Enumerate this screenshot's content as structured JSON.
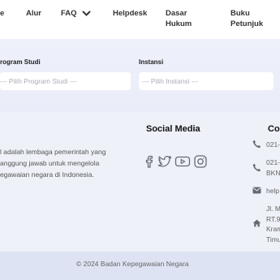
{
  "nav": {
    "items": [
      {
        "label": "e"
      },
      {
        "label": "Alur"
      },
      {
        "label": "FAQ"
      },
      {
        "label": "Helpdesk"
      },
      {
        "label_line1": "Dasar",
        "label_line2": "Hukum"
      },
      {
        "label_line1": "Buku",
        "label_line2": "Petunjuk"
      }
    ]
  },
  "filters": {
    "program_label": "rogram Studi",
    "program_placeholder": "--- Pilih Program Studi ---",
    "instansi_label": "Instansi",
    "instansi_placeholder": "--- Pilih Instansi ---"
  },
  "footer": {
    "about_lines": [
      "l adalah lembaga pemerintah yang",
      "anggung jawab untuk mengelola",
      "egawaian negara di Indonesia."
    ],
    "social_title": "Social Media",
    "social_icons": [
      "facebook-icon",
      "twitter-icon",
      "youtube-icon",
      "instagram-icon"
    ],
    "contact_title": "Co",
    "contact": {
      "phone1": "021-",
      "phone2_line1": "021-",
      "phone2_line2": "BKN",
      "email": "help",
      "address_lines": [
        "Jl. M",
        "RT.9",
        "Kram",
        "Timu"
      ]
    },
    "copyright": "© 2024  Badan Kepegawaian Negara"
  },
  "colors": {
    "band": "#eaedf9",
    "copyright_bar": "#dee3f4",
    "icon": "#666a73"
  }
}
